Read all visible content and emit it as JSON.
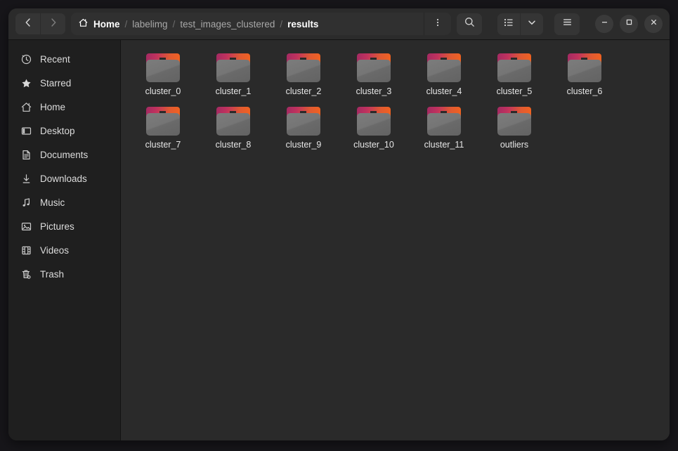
{
  "window": {
    "controls": {
      "minimize_label": "Minimize",
      "maximize_label": "Maximize",
      "close_label": "Close"
    }
  },
  "header": {
    "nav": {
      "back_label": "Back",
      "forward_label": "Forward"
    },
    "breadcrumbs": [
      {
        "label": "Home",
        "current": false,
        "home": true
      },
      {
        "label": "labelimg",
        "current": false,
        "home": false
      },
      {
        "label": "test_images_clustered",
        "current": false,
        "home": false
      },
      {
        "label": "results",
        "current": true,
        "home": false
      }
    ],
    "separator": "/",
    "path_menu_label": "Path options",
    "search_label": "Search",
    "view_list_label": "List view",
    "view_dropdown_label": "View options",
    "main_menu_label": "Main menu"
  },
  "sidebar": {
    "items": [
      {
        "label": "Recent",
        "icon": "clock-icon"
      },
      {
        "label": "Starred",
        "icon": "star-icon"
      },
      {
        "label": "Home",
        "icon": "home-icon"
      },
      {
        "label": "Desktop",
        "icon": "desktop-icon"
      },
      {
        "label": "Documents",
        "icon": "document-icon"
      },
      {
        "label": "Downloads",
        "icon": "download-icon"
      },
      {
        "label": "Music",
        "icon": "music-icon"
      },
      {
        "label": "Pictures",
        "icon": "picture-icon"
      },
      {
        "label": "Videos",
        "icon": "video-icon"
      },
      {
        "label": "Trash",
        "icon": "trash-icon"
      }
    ]
  },
  "content": {
    "items": [
      {
        "name": "cluster_0",
        "type": "folder"
      },
      {
        "name": "cluster_1",
        "type": "folder"
      },
      {
        "name": "cluster_2",
        "type": "folder"
      },
      {
        "name": "cluster_3",
        "type": "folder"
      },
      {
        "name": "cluster_4",
        "type": "folder"
      },
      {
        "name": "cluster_5",
        "type": "folder"
      },
      {
        "name": "cluster_6",
        "type": "folder"
      },
      {
        "name": "cluster_7",
        "type": "folder"
      },
      {
        "name": "cluster_8",
        "type": "folder"
      },
      {
        "name": "cluster_9",
        "type": "folder"
      },
      {
        "name": "cluster_10",
        "type": "folder"
      },
      {
        "name": "cluster_11",
        "type": "folder"
      },
      {
        "name": "outliers",
        "type": "folder"
      }
    ]
  },
  "colors": {
    "window_bg": "#242424",
    "header_bg": "#2b2b2b",
    "sidebar_bg": "#1f1f1f",
    "content_bg": "#2a2a2a",
    "folder_tab_start": "#a32a62",
    "folder_tab_end": "#f2631f",
    "folder_body": "#757575",
    "text_primary": "#ffffff",
    "text_secondary": "#a8a8a8"
  }
}
